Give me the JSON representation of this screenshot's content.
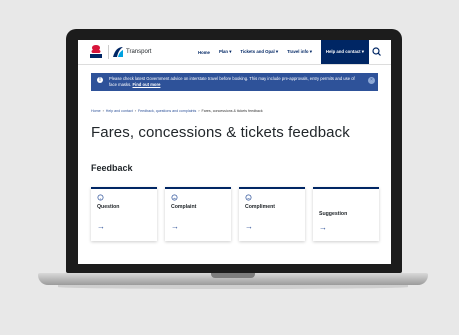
{
  "header": {
    "brand": "Transport",
    "nav": [
      "Home",
      "Plan ▾",
      "Tickets and Opal ▾",
      "Travel info ▾"
    ],
    "active_nav": "Help and contact ▾"
  },
  "alert": {
    "text": "Please check latest Government advice on interstate travel before booking. This may include pre-approvals, entry permits and use of face masks.",
    "link": "Find out more"
  },
  "breadcrumb": {
    "items": [
      "Home",
      "Help and contact",
      "Feedback, questions and complaints"
    ],
    "current": "Fares, concessions & tickets feedback"
  },
  "page": {
    "title": "Fares, concessions & tickets feedback",
    "section": "Feedback"
  },
  "cards": [
    {
      "label": "Question",
      "icon": "question-icon"
    },
    {
      "label": "Complaint",
      "icon": "complaint-icon"
    },
    {
      "label": "Compliment",
      "icon": "compliment-icon"
    },
    {
      "label": "Suggestion",
      "icon": ""
    }
  ],
  "colors": {
    "navy": "#002664",
    "alert_blue": "#2e5299",
    "text": "#22272b"
  }
}
